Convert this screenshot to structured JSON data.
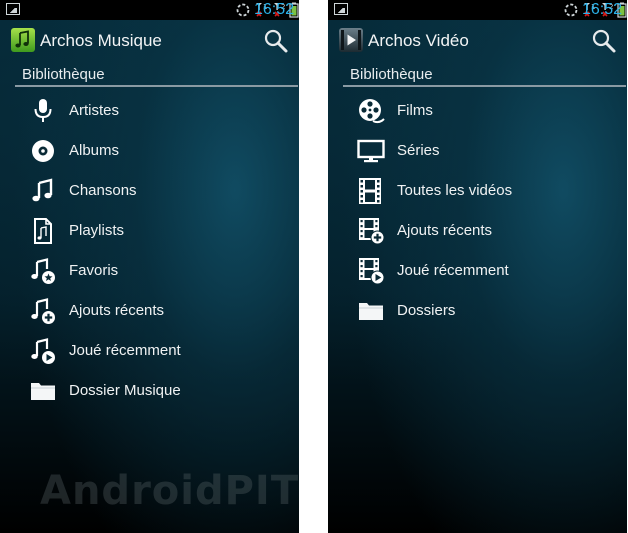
{
  "status_bar": {
    "time": "16:52",
    "sim1_label": "1",
    "sim2_label": "2"
  },
  "screens": [
    {
      "app_title": "Archos Musique",
      "section_header": "Bibliothèque",
      "items": [
        {
          "label": "Artistes",
          "icon": "microphone-icon"
        },
        {
          "label": "Albums",
          "icon": "disc-icon"
        },
        {
          "label": "Chansons",
          "icon": "music-note-icon"
        },
        {
          "label": "Playlists",
          "icon": "playlist-document-icon"
        },
        {
          "label": "Favoris",
          "icon": "music-favorite-icon"
        },
        {
          "label": "Ajouts récents",
          "icon": "music-add-icon"
        },
        {
          "label": "Joué récemment",
          "icon": "music-play-icon"
        },
        {
          "label": "Dossier Musique",
          "icon": "folder-icon"
        }
      ]
    },
    {
      "app_title": "Archos Vidéo",
      "section_header": "Bibliothèque",
      "items": [
        {
          "label": "Films",
          "icon": "film-reel-icon"
        },
        {
          "label": "Séries",
          "icon": "tv-icon"
        },
        {
          "label": "Toutes les vidéos",
          "icon": "film-strip-icon"
        },
        {
          "label": "Ajouts récents",
          "icon": "film-add-icon"
        },
        {
          "label": "Joué récemment",
          "icon": "film-play-icon"
        },
        {
          "label": "Dossiers",
          "icon": "folder-icon"
        }
      ]
    }
  ],
  "watermark": "AndroidPIT",
  "colors": {
    "accent": "#2bb1e8",
    "text": "#f0f2f3",
    "divider": "#8a9aa3",
    "background": "#041e29"
  }
}
